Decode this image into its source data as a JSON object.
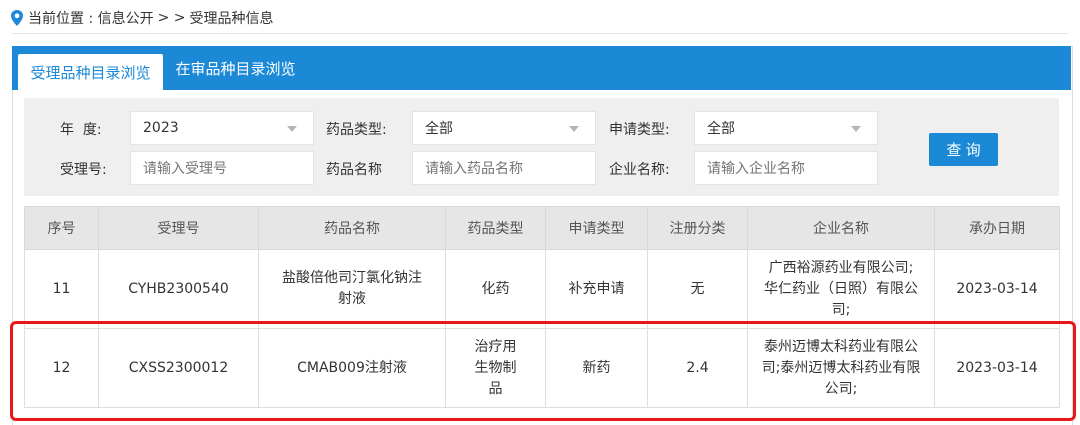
{
  "breadcrumb": {
    "location_label": "当前位置 : 信息公开",
    "separator": "> >",
    "current": "受理品种信息"
  },
  "tabs": [
    {
      "label": "受理品种目录浏览",
      "active": true
    },
    {
      "label": "在审品种目录浏览",
      "active": false
    }
  ],
  "filters": {
    "year_label": "年  度:",
    "year_value": "2023",
    "drug_type_label": "药品类型:",
    "drug_type_value": "全部",
    "apply_type_label": "申请类型:",
    "apply_type_value": "全部",
    "accept_no_label": "受理号:",
    "accept_no_placeholder": "请输入受理号",
    "drug_name_label": "药品名称",
    "drug_name_placeholder": "请输入药品名称",
    "company_label": "企业名称:",
    "company_placeholder": "请输入企业名称",
    "query_button": "查 询"
  },
  "table": {
    "headers": [
      "序号",
      "受理号",
      "药品名称",
      "药品类型",
      "申请类型",
      "注册分类",
      "企业名称",
      "承办日期"
    ],
    "rows": [
      [
        "11",
        "CYHB2300540",
        "盐酸倍他司汀氯化钠注射液",
        "化药",
        "补充申请",
        "无",
        "广西裕源药业有限公司;华仁药业（日照）有限公司;",
        "2023-03-14"
      ],
      [
        "12",
        "CXSS2300012",
        "CMAB009注射液",
        "治疗用生物制品",
        "新药",
        "2.4",
        "泰州迈博太科药业有限公司;泰州迈博太科药业有限公司;",
        "2023-03-14"
      ]
    ]
  },
  "colors": {
    "accent": "#1b89d6",
    "highlight": "#e81818"
  }
}
